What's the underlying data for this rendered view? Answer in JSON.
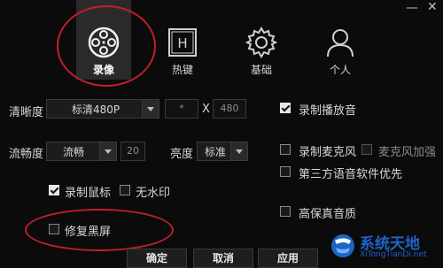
{
  "window": {
    "minimize_icon": "minimize-icon",
    "close_icon": "close-icon"
  },
  "tabs": [
    {
      "label": "录像",
      "icon": "film-reel-icon",
      "active": true
    },
    {
      "label": "热键",
      "icon": "hotkey-h-icon",
      "active": false
    },
    {
      "label": "基础",
      "icon": "gear-icon",
      "active": false
    },
    {
      "label": "个人",
      "icon": "person-icon",
      "active": false
    }
  ],
  "video": {
    "clarity_label": "清晰度",
    "clarity_value": "标清480P",
    "width_value": "*",
    "x_label": "X",
    "height_value": "480",
    "fluency_label": "流畅度",
    "fluency_value": "流畅",
    "fps_value": "20",
    "brightness_label": "亮度",
    "brightness_value": "标准"
  },
  "options": {
    "record_cursor": {
      "label": "录制鼠标",
      "checked": true
    },
    "no_watermark": {
      "label": "无水印",
      "checked": false
    },
    "fix_black_screen": {
      "label": "修复黑屏",
      "checked": false
    },
    "record_playback_audio": {
      "label": "录制播放音",
      "checked": true
    },
    "record_mic": {
      "label": "录制麦克风",
      "checked": false
    },
    "mic_boost": {
      "label": "麦克风加强",
      "checked": false
    },
    "third_party_voice_priority": {
      "label": "第三方语音软件优先",
      "checked": false
    },
    "hifi_audio": {
      "label": "高保真音质",
      "checked": false
    }
  },
  "buttons": {
    "ok": "确定",
    "cancel": "取消",
    "apply": "应用"
  },
  "watermark_logo": {
    "title": "系统天地",
    "url": "XiTongTianDi.net"
  },
  "colors": {
    "background": "#0b0b0b",
    "annotation_red": "#c0202a",
    "logo_blue": "#1e64c8"
  }
}
